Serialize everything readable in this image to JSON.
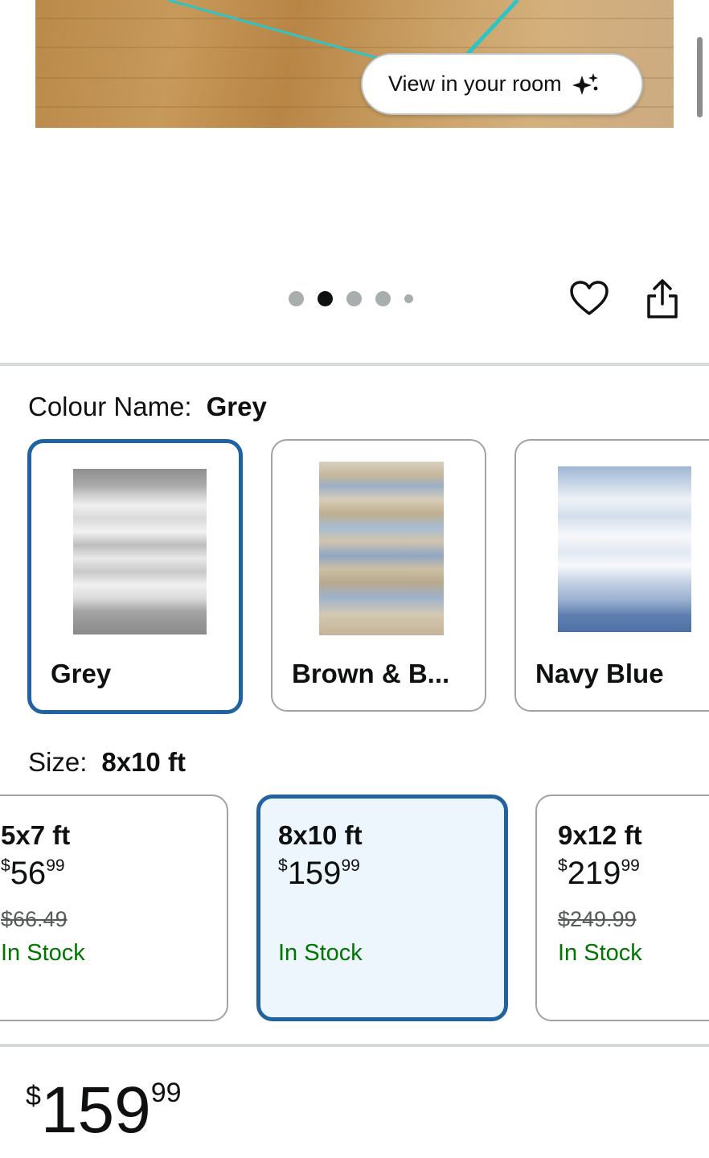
{
  "hero": {
    "view_in_room_label": "View in your room",
    "sparkle_icon": "sparkle-icon"
  },
  "carousel": {
    "dot_count": 5,
    "active_index": 1
  },
  "actions": {
    "favorite_icon": "heart-icon",
    "share_icon": "share-icon"
  },
  "colour": {
    "label": "Colour Name:",
    "selected": "Grey",
    "options": [
      {
        "label": "Grey",
        "selected": true
      },
      {
        "label": "Brown & B...",
        "selected": false
      },
      {
        "label": "Navy Blue",
        "selected": false
      }
    ]
  },
  "size": {
    "label": "Size:",
    "selected": "8x10 ft",
    "options": [
      {
        "title": "5x7 ft",
        "currency": "$",
        "whole": "56",
        "cents": "99",
        "list_price": "$66.49",
        "stock": "In Stock",
        "selected": false
      },
      {
        "title": "8x10 ft",
        "currency": "$",
        "whole": "159",
        "cents": "99",
        "list_price": "",
        "stock": "In Stock",
        "selected": true
      },
      {
        "title": "9x12 ft",
        "currency": "$",
        "whole": "219",
        "cents": "99",
        "list_price": "$249.99",
        "stock": "In Stock",
        "selected": false
      }
    ]
  },
  "price": {
    "currency": "$",
    "whole": "159",
    "cents": "99"
  },
  "colors": {
    "accent": "#2162a1",
    "in_stock": "#007600",
    "selected_bg": "#edf6fd"
  }
}
